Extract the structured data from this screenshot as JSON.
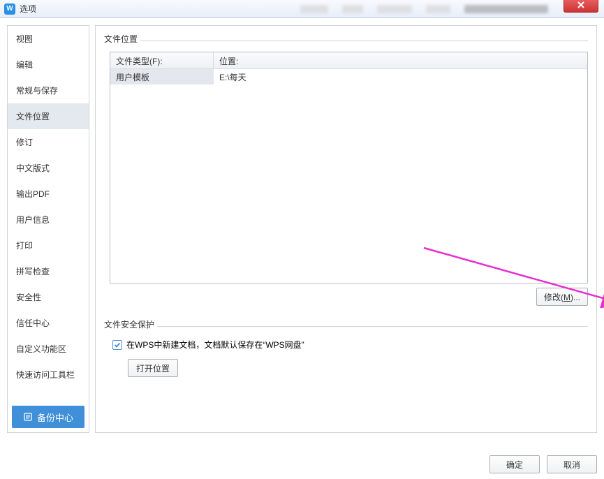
{
  "window": {
    "title": "选项",
    "app_icon_letter": "W"
  },
  "sidebar": {
    "items": [
      {
        "label": "视图"
      },
      {
        "label": "编辑"
      },
      {
        "label": "常规与保存"
      },
      {
        "label": "文件位置"
      },
      {
        "label": "修订"
      },
      {
        "label": "中文版式"
      },
      {
        "label": "输出PDF"
      },
      {
        "label": "用户信息"
      },
      {
        "label": "打印"
      },
      {
        "label": "拼写检查"
      },
      {
        "label": "安全性"
      },
      {
        "label": "信任中心"
      },
      {
        "label": "自定义功能区"
      },
      {
        "label": "快速访问工具栏"
      }
    ],
    "selected_index": 3,
    "backup_center_label": "备份中心"
  },
  "file_location": {
    "group_title": "文件位置",
    "columns": {
      "type": "文件类型(F):",
      "location": "位置:"
    },
    "rows": [
      {
        "type": "用户模板",
        "location": "E:\\每天"
      }
    ],
    "modify_button": "修改(M)..."
  },
  "file_security": {
    "group_title": "文件安全保护",
    "checkbox_label": "在WPS中新建文档，文档默认保存在“WPS网盘”",
    "open_location_button": "打开位置"
  },
  "footer": {
    "ok": "确定",
    "cancel": "取消"
  }
}
